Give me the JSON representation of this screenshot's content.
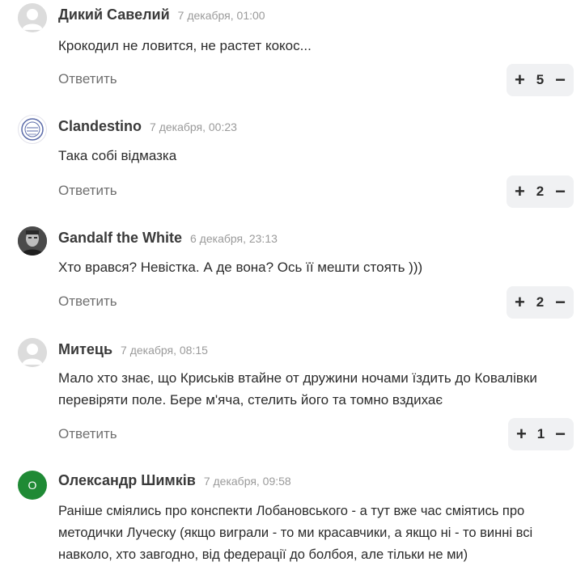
{
  "comments": [
    {
      "author": "Дикий Савелий",
      "date": "7 декабря, 01:00",
      "text": "Крокодил не ловится, не растет кокос...",
      "reply_label": "Ответить",
      "votes": "5",
      "avatar": "default-user-icon"
    },
    {
      "author": "Clandestino",
      "date": "7 декабря, 00:23",
      "text": "Така собі відмазка",
      "reply_label": "Ответить",
      "votes": "2",
      "avatar": "stamp-icon"
    },
    {
      "author": "Gandalf the White",
      "date": "6 декабря, 23:13",
      "text": "Хто врався? Невістка. А де вона? Ось її мешти стоять )))",
      "reply_label": "Ответить",
      "votes": "2",
      "avatar": "photo-portrait-icon"
    },
    {
      "author": "Митець",
      "date": "7 декабря, 08:15",
      "text": "Мало хто знає, що Криськів втайне от дружини ночами їздить до Ковалівки перевіряти поле. Бере м'яча, стелить його та томно вздихає",
      "reply_label": "Ответить",
      "votes": "1",
      "avatar": "default-user-icon"
    },
    {
      "author": "Олександр Шимків",
      "date": "7 декабря, 09:58",
      "text": "Раніше сміялись про конспекти Лобановського - а тут вже час сміятись про методички Луческу (якщо виграли - то ми красавчики, а якщо ні - то винні всі навколо, хто завгодно, від федерації до болбоя, але тільки не ми)",
      "avatar_letter": "О",
      "avatar": "letter-avatar"
    }
  ],
  "vote_controls": {
    "plus": "+",
    "minus": "−"
  },
  "colors": {
    "vote_bg": "#f0f1f3",
    "letter_avatar": "#1f8a35"
  }
}
